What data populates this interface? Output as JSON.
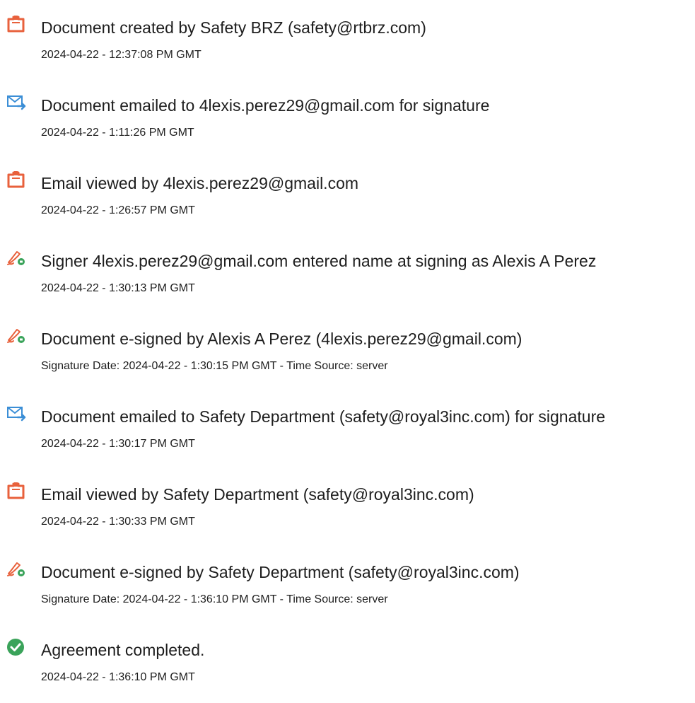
{
  "colors": {
    "accent_orange": "#e8613c",
    "accent_blue": "#3b8ed6",
    "success_green": "#3aa35a",
    "text": "#1e1e1e"
  },
  "events": [
    {
      "icon": "document-icon",
      "title": "Document created by Safety BRZ (safety@rtbrz.com)",
      "time": "2024-04-22 - 12:37:08 PM GMT"
    },
    {
      "icon": "email-sent-icon",
      "title": "Document emailed to 4lexis.perez29@gmail.com for signature",
      "time": "2024-04-22 - 1:11:26 PM GMT"
    },
    {
      "icon": "document-icon",
      "title": "Email viewed by 4lexis.perez29@gmail.com",
      "time": "2024-04-22 - 1:26:57 PM GMT"
    },
    {
      "icon": "signature-pen-icon",
      "title": "Signer 4lexis.perez29@gmail.com entered name at signing as Alexis A Perez",
      "time": "2024-04-22 - 1:30:13 PM GMT"
    },
    {
      "icon": "signature-pen-icon",
      "title": "Document e-signed by Alexis A Perez (4lexis.perez29@gmail.com)",
      "time": "Signature Date: 2024-04-22 - 1:30:15 PM GMT - Time Source: server"
    },
    {
      "icon": "email-sent-icon",
      "title": "Document emailed to Safety Department (safety@royal3inc.com) for signature",
      "time": "2024-04-22 - 1:30:17 PM GMT"
    },
    {
      "icon": "document-icon",
      "title": "Email viewed by Safety Department (safety@royal3inc.com)",
      "time": "2024-04-22 - 1:30:33 PM GMT"
    },
    {
      "icon": "signature-pen-icon",
      "title": "Document e-signed by Safety Department (safety@royal3inc.com)",
      "time": "Signature Date: 2024-04-22 - 1:36:10 PM GMT - Time Source: server"
    },
    {
      "icon": "checkmark-icon",
      "title": "Agreement completed.",
      "time": "2024-04-22 - 1:36:10 PM GMT"
    }
  ]
}
